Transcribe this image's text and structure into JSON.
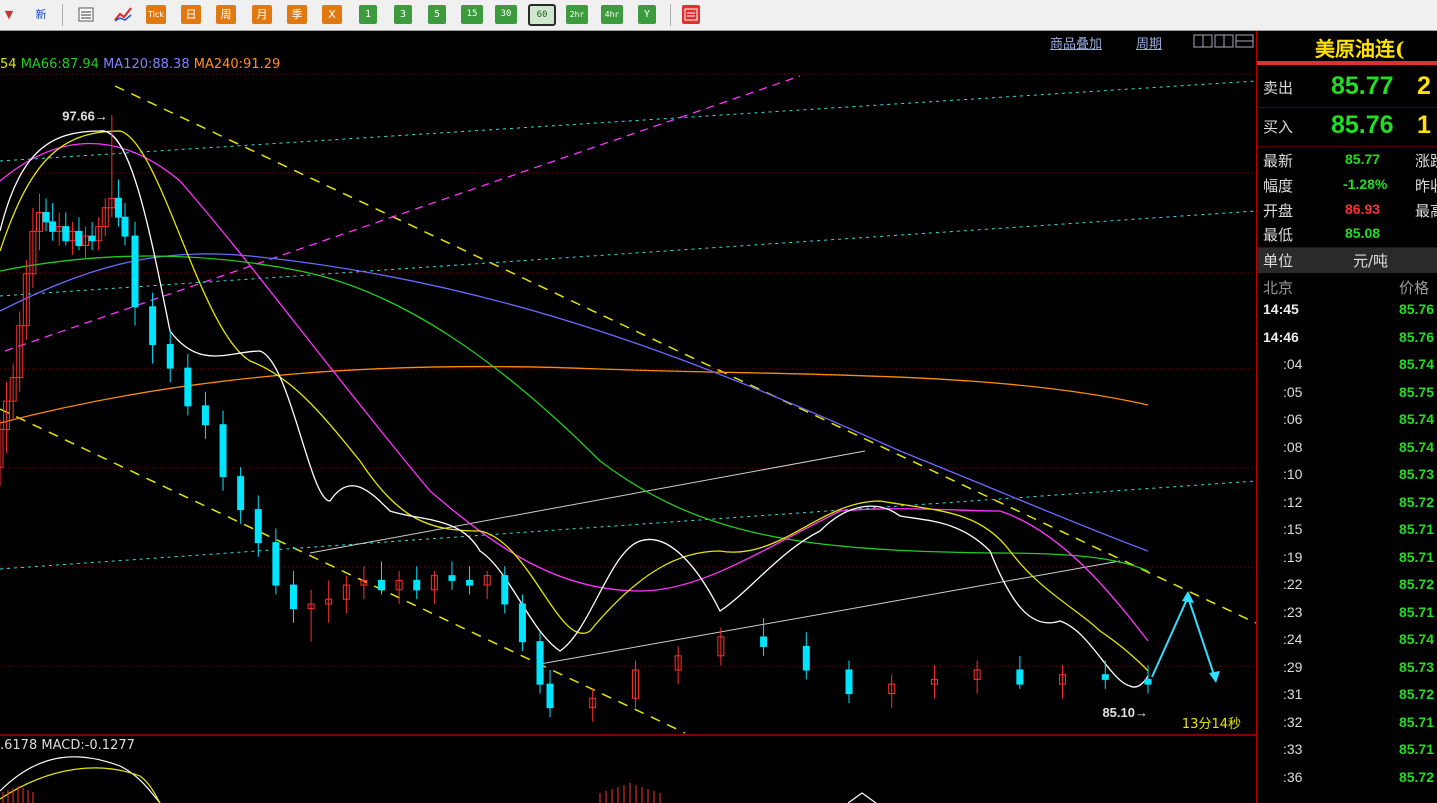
{
  "toolbar": {
    "new_label": "新",
    "tick_label": "Tick",
    "day_label": "日",
    "week_label": "周",
    "month_label": "月",
    "quarter_label": "季",
    "x_label": "X",
    "p1": "1",
    "p3": "3",
    "p5": "5",
    "p15": "15",
    "p30": "30",
    "p60": "60",
    "p2h": "2hr",
    "p4h": "4hr",
    "year_label": "Y"
  },
  "chart": {
    "links": {
      "overlay": "商品叠加",
      "period": "周期"
    },
    "ma_legend": {
      "ma_prefix": "54",
      "ma66": "MA66:87.94",
      "ma120": "MA120:88.38",
      "ma240": "MA240:91.29"
    },
    "high_label": "97.66→",
    "low_label": "85.10→",
    "countdown": "13分14秒",
    "macd_legend": {
      "left": ".6178",
      "macd": "MACD:-0.1277"
    },
    "colors": {
      "up": "#ff3030",
      "down": "#00e5ff",
      "ma5": "#ffffff",
      "ma10": "#e5e500",
      "ma20": "#ff33ff",
      "ma66": "#22cc22",
      "ma120": "#6a6aff",
      "ma240": "#ff8c00"
    }
  },
  "chart_data": {
    "type": "candlestick",
    "title": "美原油连",
    "ylim": [
      84.5,
      98.6
    ],
    "grid": "horizontal dotted red",
    "candles": [
      [
        90.2,
        91.2,
        89.8,
        91.0
      ],
      [
        91.0,
        92.0,
        90.5,
        91.6
      ],
      [
        91.6,
        92.4,
        91.2,
        92.1
      ],
      [
        92.1,
        93.5,
        91.8,
        93.2
      ],
      [
        93.2,
        94.6,
        92.9,
        94.3
      ],
      [
        94.3,
        95.7,
        94.0,
        95.2
      ],
      [
        95.2,
        96.0,
        94.8,
        95.6
      ],
      [
        95.6,
        95.9,
        95.2,
        95.4
      ],
      [
        95.4,
        95.8,
        95.0,
        95.2
      ],
      [
        95.2,
        95.6,
        94.9,
        95.3
      ],
      [
        95.3,
        95.6,
        94.9,
        95.0
      ],
      [
        95.0,
        95.4,
        94.7,
        95.2
      ],
      [
        95.2,
        95.5,
        94.8,
        94.9
      ],
      [
        94.9,
        95.3,
        94.6,
        95.1
      ],
      [
        95.1,
        95.4,
        94.8,
        95.0
      ],
      [
        95.0,
        95.5,
        94.8,
        95.3
      ],
      [
        95.3,
        95.9,
        95.1,
        95.7
      ],
      [
        95.7,
        97.66,
        95.5,
        95.9
      ],
      [
        95.9,
        96.3,
        95.3,
        95.5
      ],
      [
        95.5,
        95.8,
        94.9,
        95.1
      ],
      [
        95.1,
        95.4,
        93.2,
        93.6
      ],
      [
        93.6,
        93.9,
        92.4,
        92.8
      ],
      [
        92.8,
        93.1,
        92.0,
        92.3
      ],
      [
        92.3,
        92.6,
        91.3,
        91.5
      ],
      [
        91.5,
        91.8,
        90.8,
        91.1
      ],
      [
        91.1,
        91.4,
        89.7,
        90.0
      ],
      [
        90.0,
        90.2,
        89.0,
        89.3
      ],
      [
        89.3,
        89.6,
        88.3,
        88.6
      ],
      [
        88.6,
        88.9,
        87.5,
        87.7
      ],
      [
        87.7,
        88.0,
        86.9,
        87.2
      ],
      [
        87.2,
        87.6,
        86.5,
        87.3
      ],
      [
        87.3,
        87.8,
        86.9,
        87.4
      ],
      [
        87.4,
        87.9,
        87.1,
        87.7
      ],
      [
        87.7,
        88.1,
        87.4,
        87.8
      ],
      [
        87.8,
        88.2,
        87.5,
        87.6
      ],
      [
        87.6,
        88.0,
        87.3,
        87.8
      ],
      [
        87.8,
        88.1,
        87.4,
        87.6
      ],
      [
        87.6,
        88.0,
        87.3,
        87.9
      ],
      [
        87.9,
        88.2,
        87.6,
        87.8
      ],
      [
        87.8,
        88.1,
        87.5,
        87.7
      ],
      [
        87.7,
        88.0,
        87.4,
        87.9
      ],
      [
        87.9,
        88.1,
        87.1,
        87.3
      ],
      [
        87.3,
        87.5,
        86.3,
        86.5
      ],
      [
        86.5,
        86.7,
        85.4,
        85.6
      ],
      [
        85.6,
        85.9,
        84.9,
        85.1
      ],
      [
        85.1,
        85.5,
        84.8,
        85.3
      ],
      [
        85.3,
        86.1,
        85.1,
        85.9
      ],
      [
        85.9,
        86.4,
        85.6,
        86.2
      ],
      [
        86.2,
        86.8,
        86.0,
        86.6
      ],
      [
        86.6,
        87.0,
        86.2,
        86.4
      ],
      [
        86.4,
        86.7,
        85.7,
        85.9
      ],
      [
        85.9,
        86.1,
        85.2,
        85.4
      ],
      [
        85.4,
        85.8,
        85.1,
        85.6
      ],
      [
        85.6,
        86.0,
        85.3,
        85.7
      ],
      [
        85.7,
        86.1,
        85.4,
        85.9
      ],
      [
        85.9,
        86.2,
        85.5,
        85.6
      ],
      [
        85.6,
        86.0,
        85.3,
        85.8
      ],
      [
        85.8,
        86.1,
        85.5,
        85.7
      ],
      [
        85.7,
        86.0,
        85.4,
        85.6
      ]
    ],
    "high_marker": 97.66,
    "low_marker": 85.1
  },
  "quote": {
    "title": "美原油连(",
    "sell_label": "卖出",
    "sell_price": "85.77",
    "sell_qty": "2",
    "buy_label": "买入",
    "buy_price": "85.76",
    "buy_qty": "1",
    "latest_label": "最新",
    "latest": "85.77",
    "change_label": "涨跌",
    "range_label": "幅度",
    "range": "-1.28%",
    "prev_label": "昨收",
    "open_label": "开盘",
    "open": "86.93",
    "high_label": "最高",
    "low_label": "最低",
    "low": "85.08",
    "unit_label": "单位",
    "unit": "元/吨",
    "beijing_label": "北京",
    "price_label": "价格",
    "ticks": [
      {
        "t": "14:45",
        "p": "85.76",
        "bold": true
      },
      {
        "t": "14:46",
        "p": "85.76",
        "bold": true
      },
      {
        "t": ":04",
        "p": "85.74"
      },
      {
        "t": ":05",
        "p": "85.75"
      },
      {
        "t": ":06",
        "p": "85.74"
      },
      {
        "t": ":08",
        "p": "85.74"
      },
      {
        "t": ":10",
        "p": "85.73"
      },
      {
        "t": ":12",
        "p": "85.72"
      },
      {
        "t": ":15",
        "p": "85.71"
      },
      {
        "t": ":19",
        "p": "85.71"
      },
      {
        "t": ":22",
        "p": "85.72"
      },
      {
        "t": ":23",
        "p": "85.71"
      },
      {
        "t": ":24",
        "p": "85.74"
      },
      {
        "t": ":29",
        "p": "85.73"
      },
      {
        "t": ":31",
        "p": "85.72"
      },
      {
        "t": ":32",
        "p": "85.71"
      },
      {
        "t": ":33",
        "p": "85.71"
      },
      {
        "t": ":36",
        "p": "85.72"
      }
    ]
  }
}
